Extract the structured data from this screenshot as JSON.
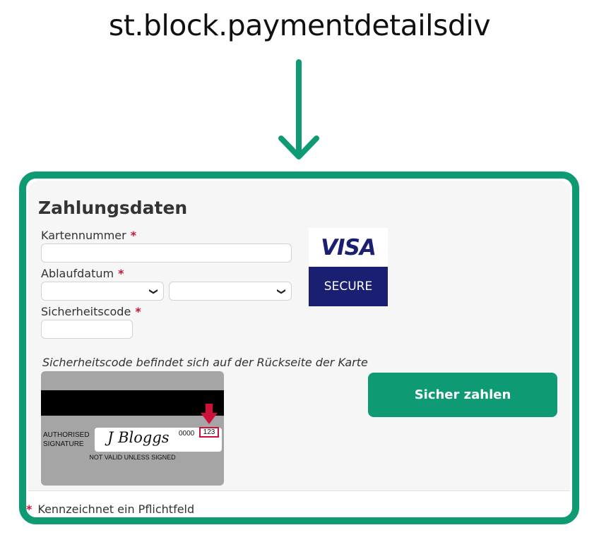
{
  "caption": "st.block.paymentdetailsdiv",
  "colors": {
    "frame": "#0e9a72",
    "required": "#d0103a",
    "button": "#0e9a72",
    "visa_blue": "#1a1f71"
  },
  "form": {
    "title": "Zahlungsdaten",
    "card_number_label": "Kartennummer",
    "expiry_label": "Ablaufdatum",
    "security_code_label": "Sicherheitscode",
    "required_mark": "*",
    "security_hint": "Sicherheitscode befindet sich auf der Rückseite der Karte",
    "card_number_value": "",
    "expiry_month_value": "",
    "expiry_year_value": "",
    "security_code_value": ""
  },
  "visa": {
    "brand": "VISA",
    "secure": "SECURE"
  },
  "card_image": {
    "authorised_line1": "AUTHORISED",
    "authorised_line2": "SIGNATURE",
    "signature": "J Bloggs",
    "number": "0000",
    "cvv": "123",
    "not_valid": "NOT VALID UNLESS SIGNED"
  },
  "pay_button": "Sicher zahlen",
  "footer": {
    "mark": "*",
    "text": "Kennzeichnet ein Pflichtfeld"
  }
}
